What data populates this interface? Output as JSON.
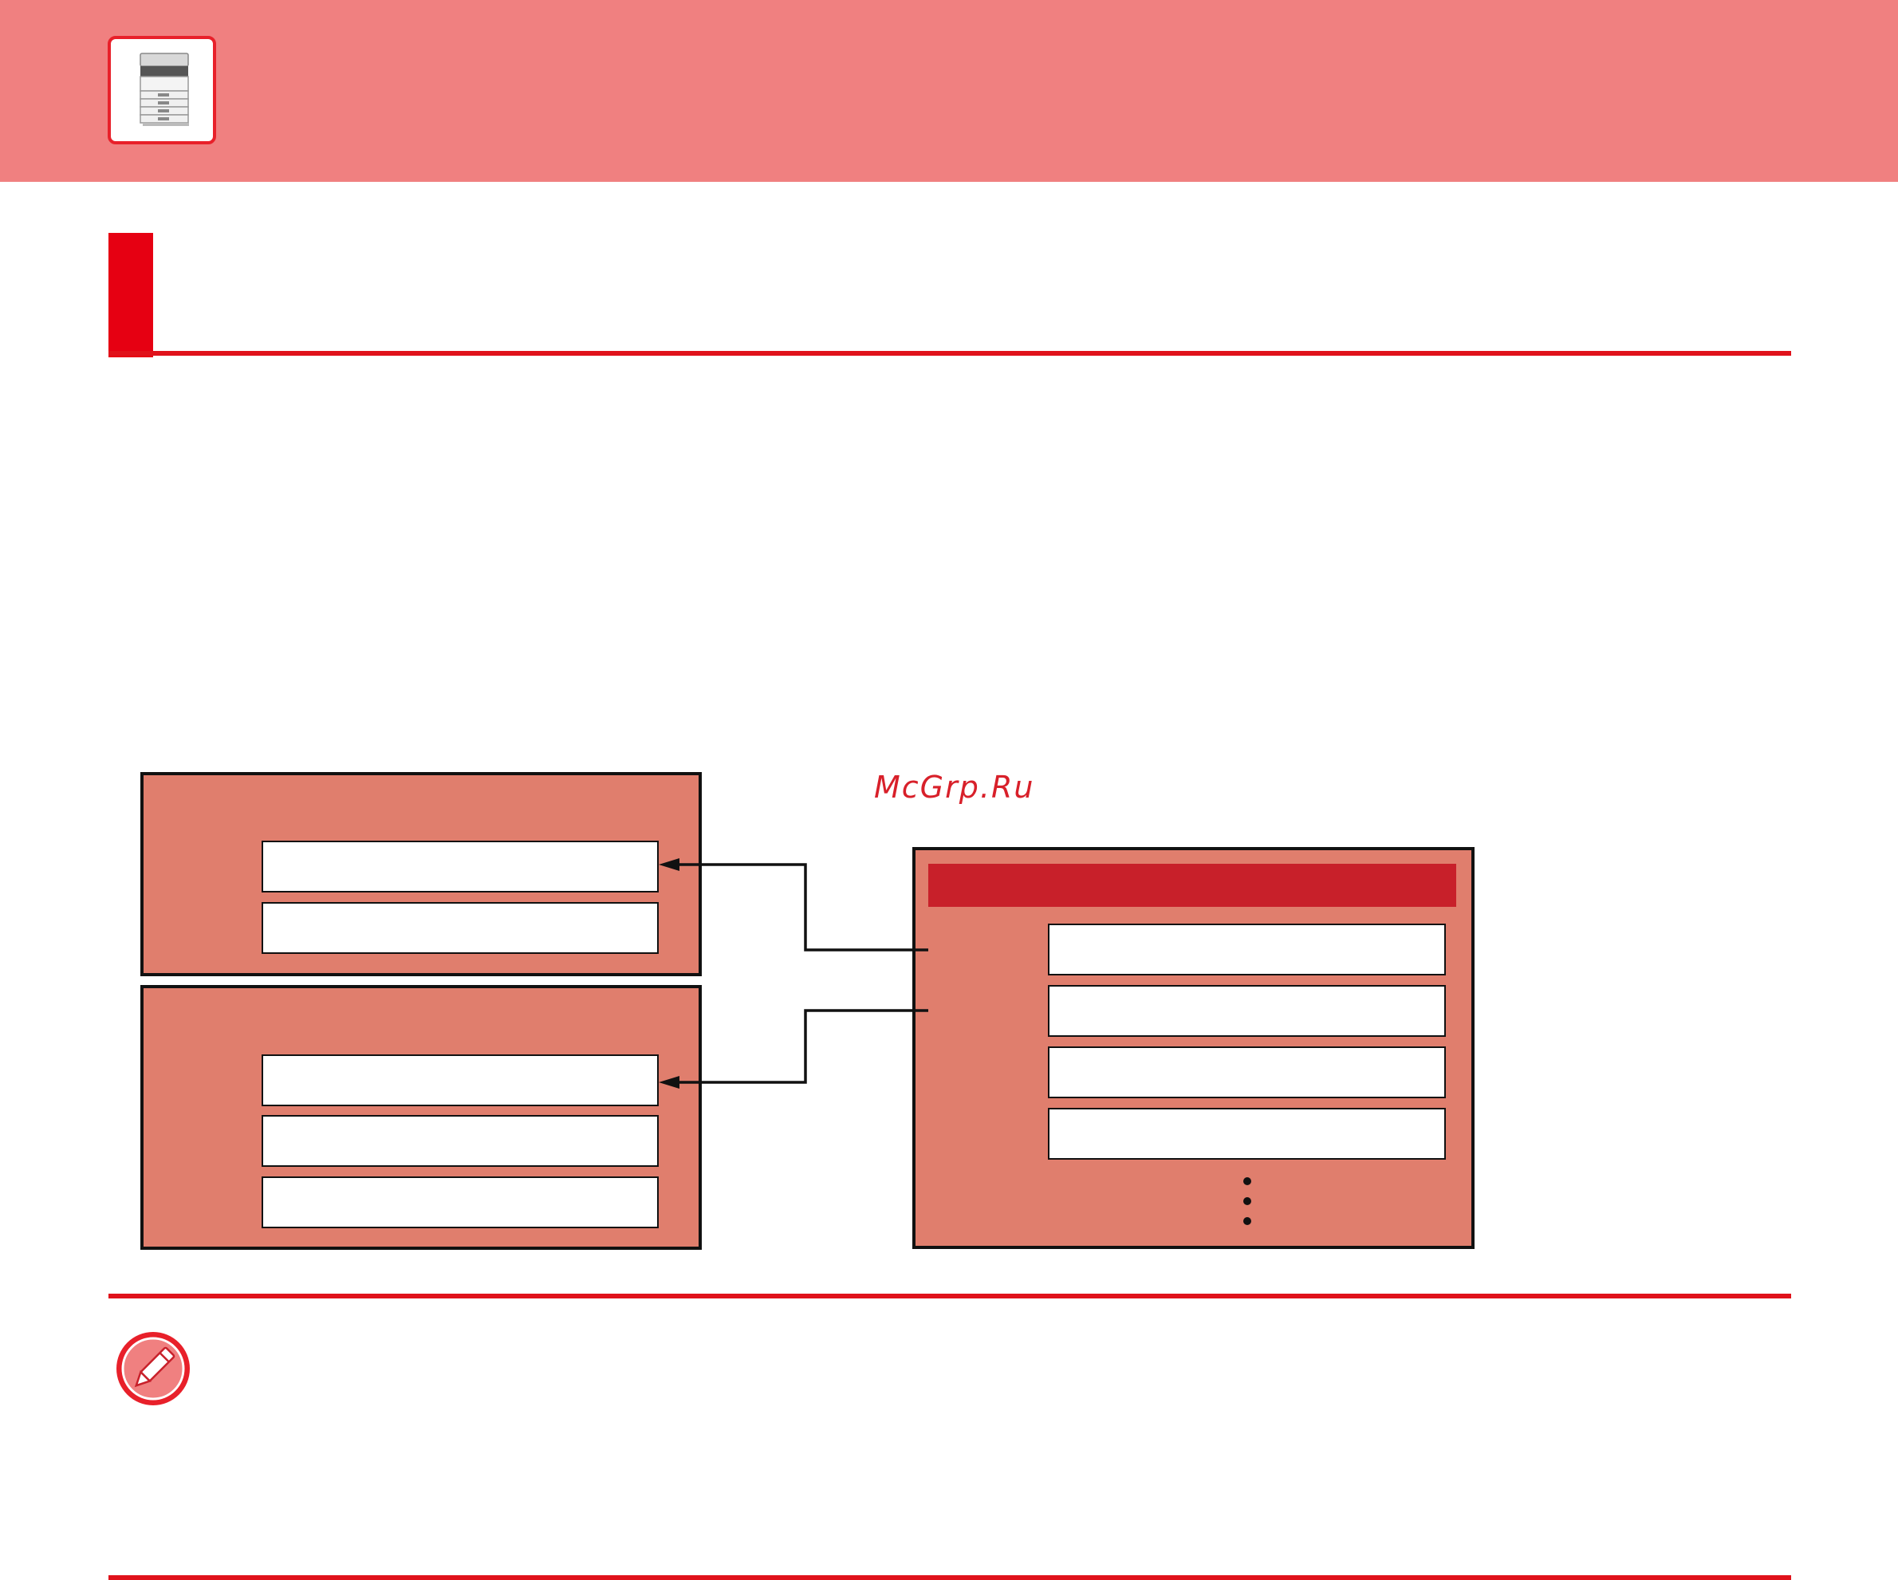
{
  "header": {
    "icon": "copier-machine-icon",
    "band_color": "#f08080"
  },
  "watermark": {
    "text": "McGrp.Ru"
  },
  "note": {
    "icon": "pencil-note-icon"
  },
  "diagram": {
    "fill_color": "#e07e6d",
    "title_bar_color": "#c8202a",
    "left_box_upper": {
      "fields": 2
    },
    "left_box_lower": {
      "fields": 3
    },
    "right_box": {
      "fields": 4,
      "has_more": true
    }
  }
}
